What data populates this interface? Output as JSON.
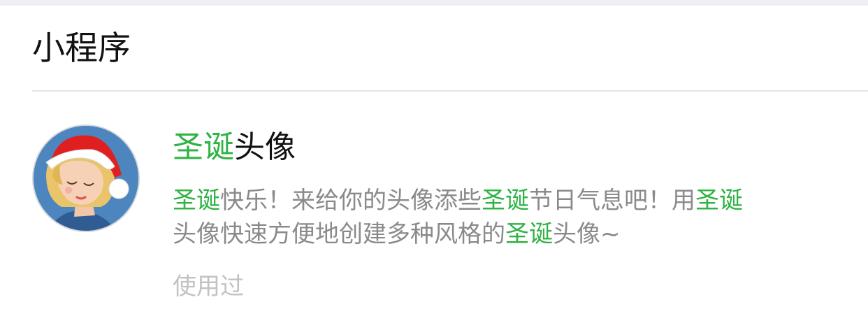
{
  "section": {
    "title": "小程序"
  },
  "result": {
    "title_highlight": "圣诞",
    "title_rest": "头像",
    "description": {
      "line1": [
        {
          "text": "圣诞",
          "highlight": true
        },
        {
          "text": "快乐！来给你的头像添些",
          "highlight": false
        },
        {
          "text": "圣诞",
          "highlight": true
        },
        {
          "text": "节日气息吧！用",
          "highlight": false
        },
        {
          "text": "圣诞",
          "highlight": true
        }
      ],
      "line2": [
        {
          "text": "头像快速方便地创建多种风格的",
          "highlight": false
        },
        {
          "text": "圣诞",
          "highlight": true
        },
        {
          "text": "头像~",
          "highlight": false
        }
      ]
    },
    "tag": "使用过"
  },
  "colors": {
    "highlight": "#2fb344",
    "title_text": "#111111",
    "desc_text": "#8a8a8a",
    "tag_text": "#c2c2c2",
    "divider": "#e3e3e3",
    "top_strip": "#efeff4"
  },
  "icons": {
    "avatar": "santa-hat-princess-avatar"
  }
}
